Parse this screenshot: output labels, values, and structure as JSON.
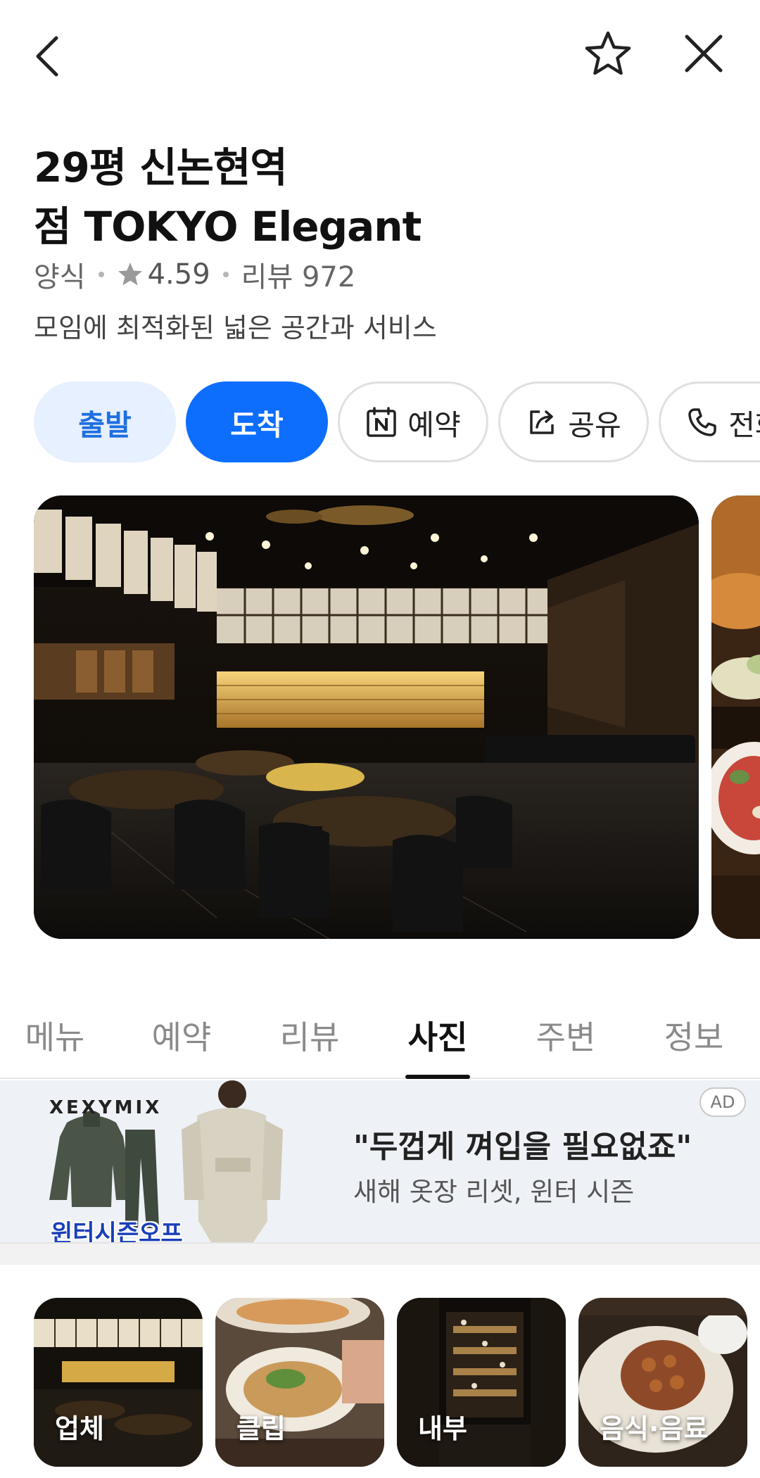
{
  "header": {
    "back_icon": "chevron-left-icon",
    "favorite_icon": "star-outline-icon",
    "close_icon": "close-icon"
  },
  "place": {
    "title_line1": "29평 신논현역",
    "title_line2": "점 TOKYO Elegant",
    "category": "양식",
    "rating": "4.59",
    "review_text": "리뷰 972",
    "description": "모임에 최적화된 넓은 공간과 서비스"
  },
  "actions": {
    "depart_label": "출발",
    "arrive_label": "도착",
    "reserve_label": "예약",
    "share_label": "공유",
    "call_label": "전화"
  },
  "tabs": [
    "메뉴",
    "예약",
    "리뷰",
    "사진",
    "주변",
    "정보"
  ],
  "active_tab": "사진",
  "ad": {
    "badge": "AD",
    "brand": "XEXYMIX",
    "promo": "윈터시즌오프",
    "headline": "\"두껍게 껴입을 필요없죠\"",
    "subtext": "새해 옷장 리셋, 윈터 시즌"
  },
  "photo_categories": [
    "업체",
    "클립",
    "내부",
    "음식·음료"
  ],
  "colors": {
    "primary_blue": "#0d6efd",
    "light_blue": "#e6f0ff",
    "ad_background": "#eef1f6"
  }
}
